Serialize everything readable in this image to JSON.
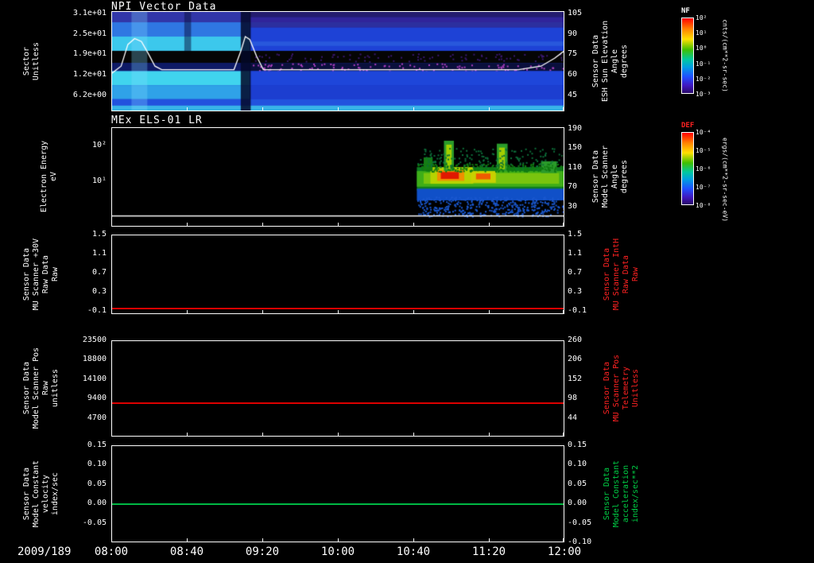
{
  "header": {
    "date_label": "2009/189"
  },
  "x_axis": {
    "tick_labels": [
      "08:00",
      "08:40",
      "09:20",
      "10:00",
      "10:40",
      "11:20",
      "12:00"
    ]
  },
  "colors": {
    "accent_red": "#ff2222",
    "accent_green": "#00cc44",
    "axis_white": "#ffffff",
    "background": "#000000"
  },
  "panels": [
    {
      "id": "npi",
      "title": "NPI Vector Data",
      "left_label_lines": [
        "Sector",
        "Unitless"
      ],
      "left_ticks": [
        "3.1e+01",
        "2.5e+01",
        "1.9e+01",
        "1.2e+01",
        "6.2e+00"
      ],
      "right_ticks": [
        "105",
        "90",
        "75",
        "60",
        "45"
      ],
      "right_label_lines": [
        "Sensor Data",
        "ESH Sun Elevation",
        "Angle",
        "degrees"
      ]
    },
    {
      "id": "els",
      "title": "MEx ELS-01 LR",
      "left_label_lines": [
        "Electron Energy",
        "eV"
      ],
      "left_ticks": [
        "10²",
        "10¹"
      ],
      "right_ticks": [
        "190",
        "150",
        "110",
        "70",
        "30"
      ],
      "right_label_lines": [
        "Sensor Data",
        "Model Scanner",
        "Angle",
        "degrees"
      ]
    },
    {
      "id": "mu30v",
      "left_label_lines": [
        "Sensor Data",
        "MU Scanner +30V",
        "Raw Data",
        "Raw"
      ],
      "left_ticks": [
        "1.5",
        "1.1",
        "0.7",
        "0.3",
        "-0.1"
      ],
      "right_ticks": [
        "1.5",
        "1.1",
        "0.7",
        "0.3",
        "-0.1"
      ],
      "right_label_lines": [
        "Sensor Data",
        "MU Scanner IntH",
        "Raw Data",
        "Raw"
      ],
      "line": {
        "color": "#dd0000",
        "value": 0.03,
        "ymin": -0.1,
        "ymax": 1.5
      }
    },
    {
      "id": "scannerpos",
      "left_label_lines": [
        "Sensor Data",
        "Model Scanner Pos",
        "Raw",
        "unitless"
      ],
      "left_ticks": [
        "23500",
        "18800",
        "14100",
        "9400",
        "4700"
      ],
      "right_ticks": [
        "260",
        "206",
        "152",
        "98",
        "44"
      ],
      "right_label_lines": [
        "Sensor Data",
        "MU Scanner Pos",
        "Telemetry",
        "Unitless"
      ],
      "line": {
        "color": "#dd0000",
        "value": 8400,
        "ymin": 0,
        "ymax": 23500
      }
    },
    {
      "id": "velocity",
      "left_label_lines": [
        "Sensor Data",
        "Model Constant",
        "velocity",
        "index/sec"
      ],
      "left_ticks": [
        "0.15",
        "0.10",
        "0.05",
        "0.00",
        "-0.05"
      ],
      "right_ticks": [
        "0.15",
        "0.10",
        "0.05",
        "0.00",
        "-0.05",
        "-0.10"
      ],
      "right_label_lines": [
        "Sensor Data",
        "Model Constant",
        "acceleration",
        "index/sec**2"
      ],
      "line": {
        "color": "#00b844",
        "value": 0.0,
        "ymin": -0.1,
        "ymax": 0.15
      }
    }
  ],
  "colorbars": [
    {
      "id": "nf",
      "title": "NF",
      "title_color": "#ffffff",
      "ticks": [
        "10²",
        "10¹",
        "10⁰",
        "10⁻¹",
        "10⁻²",
        "10⁻³"
      ],
      "units": "cnts/(cm**2-sr-sec)"
    },
    {
      "id": "def",
      "title": "DEF",
      "title_color": "#ff2222",
      "ticks": [
        "10⁻⁴",
        "10⁻⁵",
        "10⁻⁶",
        "10⁻⁷",
        "10⁻⁸"
      ],
      "units": "ergs/(cm**2-sr-sec-eV)"
    }
  ],
  "chart_data": [
    {
      "type": "heatmap",
      "title": "NPI Vector Data",
      "ylabel": "Sector (Unitless)",
      "ytick_values": [
        31,
        25,
        19,
        12,
        6.2
      ],
      "right_axis": {
        "label": "ESH Sun Elevation Angle (degrees)",
        "ticks": [
          105,
          90,
          75,
          60,
          45
        ]
      },
      "x_range": [
        "2009/189 08:00",
        "12:00"
      ],
      "colorbar": {
        "name": "NF",
        "units": "cnts/(cm**2-sr-sec)",
        "scale": "log"
      },
      "description": "Blue/cyan sector-vs-time count-rate spectrogram; black band near sectors 15-19; brighter cyan sectors before ~09:20; white ESH sun-elevation overlay curve with peaks near 08:10 and 09:15, flat ~60 deg afterwards, rising at far right",
      "bands": [
        {
          "x0": 0,
          "y0": 0,
          "x1": 1,
          "y1": 1,
          "c": "#1c38c8"
        },
        {
          "x0": 0,
          "y0": 0,
          "x1": 1,
          "y1": 0.105,
          "c": "#3136a8"
        },
        {
          "x0": 0.305,
          "y0": 0,
          "x1": 1,
          "y1": 0.055,
          "c": "#241c6e"
        },
        {
          "x0": 0.305,
          "y0": 0.055,
          "x1": 1,
          "y1": 0.105,
          "c": "#30249a"
        },
        {
          "x0": 0.305,
          "y0": 0.105,
          "x1": 1,
          "y1": 0.16,
          "c": "#2c2f9e"
        },
        {
          "x0": 0,
          "y0": 0.105,
          "x1": 0.305,
          "y1": 0.25,
          "c": "#2f77e2"
        },
        {
          "x0": 0,
          "y0": 0.25,
          "x1": 0.305,
          "y1": 0.395,
          "c": "#3cc8ec"
        },
        {
          "x0": 0.305,
          "y0": 0.16,
          "x1": 1,
          "y1": 0.395,
          "c": "#1e42d6"
        },
        {
          "x0": 0.305,
          "y0": 0.3,
          "x1": 1,
          "y1": 0.345,
          "c": "#2858dc"
        },
        {
          "x0": 0,
          "y0": 0.395,
          "x1": 1,
          "y1": 0.52,
          "c": "#050505"
        },
        {
          "x0": 0.31,
          "y0": 0.42,
          "x1": 1,
          "y1": 0.5,
          "c": "#3a1870",
          "n": 90
        },
        {
          "x0": 0,
          "y0": 0.52,
          "x1": 0.305,
          "y1": 0.6,
          "c": "#0e1a66"
        },
        {
          "x0": 0.305,
          "y0": 0.52,
          "x1": 1,
          "y1": 0.6,
          "c": "#0a0f3c"
        },
        {
          "x0": 0.31,
          "y0": 0.52,
          "x1": 1,
          "y1": 0.6,
          "c": "#b040c0",
          "n": 110
        },
        {
          "x0": 0,
          "y0": 0.6,
          "x1": 0.305,
          "y1": 0.745,
          "c": "#40d4ee"
        },
        {
          "x0": 0.305,
          "y0": 0.6,
          "x1": 1,
          "y1": 0.745,
          "c": "#1e46da"
        },
        {
          "x0": 0,
          "y0": 0.745,
          "x1": 0.305,
          "y1": 0.885,
          "c": "#2fa2e8"
        },
        {
          "x0": 0.305,
          "y0": 0.745,
          "x1": 1,
          "y1": 0.885,
          "c": "#1c3ed0"
        },
        {
          "x0": 0,
          "y0": 0.885,
          "x1": 1,
          "y1": 1,
          "c": "#2252de"
        },
        {
          "x0": 0,
          "y0": 0.95,
          "x1": 1,
          "y1": 1,
          "c": "#38b4e8"
        },
        {
          "x0": 0.043,
          "y0": 0,
          "x1": 0.078,
          "y1": 1,
          "c": "rgba(130,220,255,0.30)"
        },
        {
          "x0": 0.16,
          "y0": 0,
          "x1": 0.175,
          "y1": 0.395,
          "c": "rgba(10,16,60,0.5)"
        },
        {
          "x0": 0.285,
          "y0": 0,
          "x1": 0.307,
          "y1": 1,
          "c": "rgba(4,8,40,0.85)"
        }
      ],
      "overlay_curve": [
        [
          0,
          0.62
        ],
        [
          0.02,
          0.55
        ],
        [
          0.035,
          0.33
        ],
        [
          0.05,
          0.27
        ],
        [
          0.065,
          0.3
        ],
        [
          0.08,
          0.42
        ],
        [
          0.095,
          0.55
        ],
        [
          0.11,
          0.585
        ],
        [
          0.27,
          0.585
        ],
        [
          0.285,
          0.4
        ],
        [
          0.295,
          0.25
        ],
        [
          0.305,
          0.28
        ],
        [
          0.32,
          0.45
        ],
        [
          0.335,
          0.585
        ],
        [
          0.9,
          0.585
        ],
        [
          0.95,
          0.55
        ],
        [
          0.98,
          0.47
        ],
        [
          1,
          0.4
        ]
      ]
    },
    {
      "type": "heatmap",
      "title": "MEx ELS-01 LR",
      "ylabel": "Electron Energy (eV)",
      "ytick_values": [
        100,
        10
      ],
      "right_axis": {
        "label": "Model Scanner Angle (degrees)",
        "ticks": [
          190,
          150,
          110,
          70,
          30
        ]
      },
      "colorbar": {
        "name": "DEF",
        "units": "ergs/(cm**2-sr-sec-eV)",
        "scale": "log"
      },
      "description": "No data before ~10:42; from ~10:42 to 12:00 enhanced electron flux band ~5-30 eV with red/orange cores near 10:55 and 11:10, green/yellow spikes reaching ~100 eV near 10:57 and 11:25, blue speckle at low energy; white horizontal trace near panel bottom across full width",
      "bands": [
        {
          "x0": 0.675,
          "y0": 0.4,
          "x1": 1,
          "y1": 0.64,
          "c": "#0e7d22"
        },
        {
          "x0": 0.675,
          "y0": 0.62,
          "x1": 1,
          "y1": 0.74,
          "c": "#1050c8"
        },
        {
          "x0": 0.675,
          "y0": 0.7,
          "x1": 1,
          "y1": 0.9,
          "c": "#1a58d0",
          "n": 420
        },
        {
          "x0": 0.675,
          "y0": 0.44,
          "x1": 1,
          "y1": 0.6,
          "c": "#3fae18"
        },
        {
          "x0": 0.69,
          "y0": 0.46,
          "x1": 0.99,
          "y1": 0.57,
          "c": "#79c40e"
        },
        {
          "x0": 0.705,
          "y0": 0.4,
          "x1": 0.8,
          "y1": 0.57,
          "c": "#b7d400"
        },
        {
          "x0": 0.72,
          "y0": 0.43,
          "x1": 0.78,
          "y1": 0.54,
          "c": "#ef9000"
        },
        {
          "x0": 0.728,
          "y0": 0.45,
          "x1": 0.768,
          "y1": 0.52,
          "c": "#e01800"
        },
        {
          "x0": 0.795,
          "y0": 0.44,
          "x1": 0.85,
          "y1": 0.56,
          "c": "#c8d000"
        },
        {
          "x0": 0.806,
          "y0": 0.465,
          "x1": 0.838,
          "y1": 0.525,
          "c": "#ef5a00"
        },
        {
          "x0": 0.735,
          "y0": 0.13,
          "x1": 0.757,
          "y1": 0.44,
          "c": "#2b9b2b"
        },
        {
          "x0": 0.74,
          "y0": 0.17,
          "x1": 0.752,
          "y1": 0.42,
          "c": "#a3cf00"
        },
        {
          "x0": 0.852,
          "y0": 0.16,
          "x1": 0.876,
          "y1": 0.44,
          "c": "#2b9b2b"
        },
        {
          "x0": 0.857,
          "y0": 0.2,
          "x1": 0.87,
          "y1": 0.42,
          "c": "#a3cf00"
        },
        {
          "x0": 0.69,
          "y0": 0.3,
          "x1": 0.71,
          "y1": 0.44,
          "c": "#157d15"
        },
        {
          "x0": 0.95,
          "y0": 0.34,
          "x1": 0.985,
          "y1": 0.46,
          "c": "#2b9b2b"
        },
        {
          "x0": 0.675,
          "y0": 0.36,
          "x1": 1,
          "y1": 0.44,
          "c": "#117a11",
          "n": 250
        },
        {
          "x0": 0.675,
          "y0": 0.2,
          "x1": 1,
          "y1": 0.4,
          "c": "#0d6f3a",
          "n": 160
        },
        {
          "x0": 0,
          "y0": 0.893,
          "x1": 1,
          "y1": 0.905,
          "c": "#ffffff"
        }
      ]
    },
    {
      "type": "line",
      "name": "MU Scanner +30V Raw Data (Raw)",
      "color": "#dd0000",
      "y_range": [
        -0.1,
        1.5
      ],
      "constant_value": 0.03
    },
    {
      "type": "line",
      "name": "Model Scanner Pos Raw (unitless)",
      "color": "#dd0000",
      "y_range": [
        0,
        23500
      ],
      "constant_value": 8400
    },
    {
      "type": "line",
      "name": "Model Constant velocity (index/sec)",
      "color": "#00b844",
      "y_range": [
        -0.1,
        0.15
      ],
      "constant_value": 0.0
    }
  ]
}
